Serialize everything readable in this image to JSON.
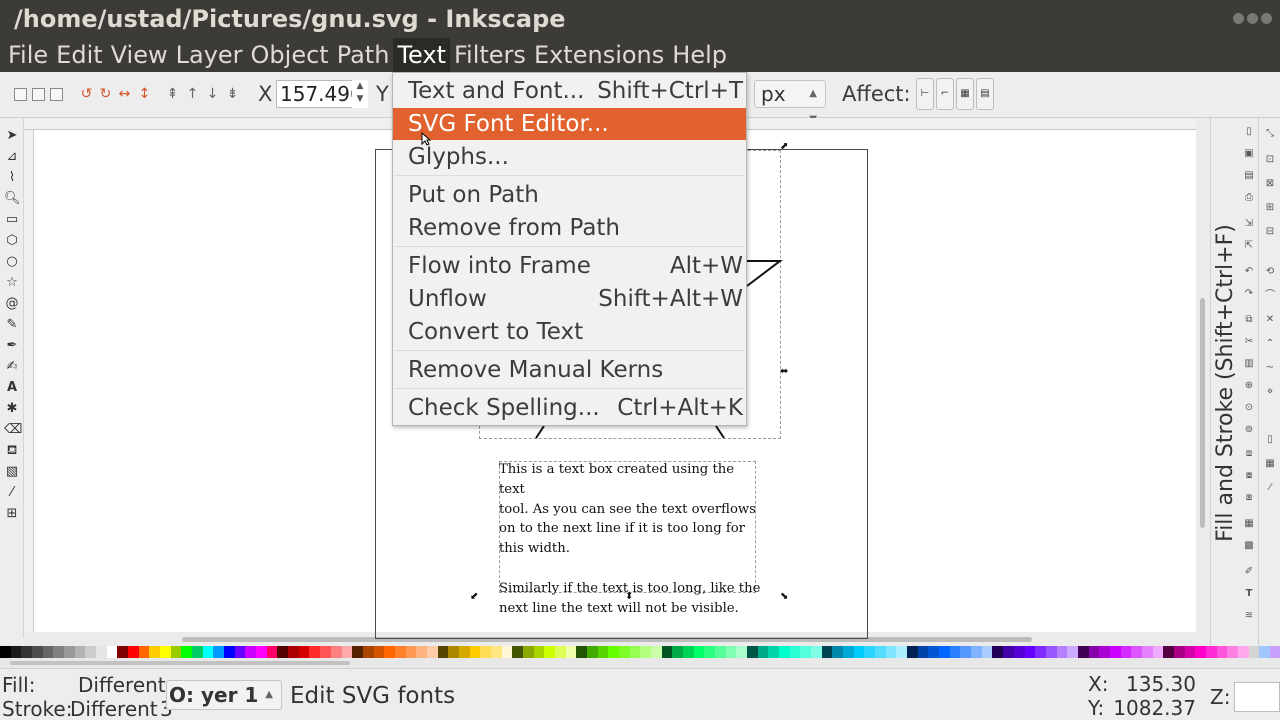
{
  "window": {
    "title": "/home/ustad/Pictures/gnu.svg - Inkscape"
  },
  "menubar": {
    "items": [
      "File",
      "Edit",
      "View",
      "Layer",
      "Object",
      "Path",
      "Text",
      "Filters",
      "Extensions",
      "Help"
    ],
    "active": "Text"
  },
  "toolbar": {
    "x_label": "X",
    "x_value": "157.496",
    "y_label": "Y",
    "unit": "px",
    "affect_label": "Affect:"
  },
  "text_menu": {
    "items": [
      {
        "label": "Text and Font...",
        "shortcut": "Shift+Ctrl+T"
      },
      {
        "label": "SVG Font Editor...",
        "shortcut": "",
        "highlighted": true
      },
      {
        "label": "Glyphs...",
        "shortcut": ""
      },
      {
        "label": "Put on Path",
        "shortcut": ""
      },
      {
        "label": "Remove from Path",
        "shortcut": ""
      },
      {
        "label": "Flow into Frame",
        "shortcut": "Alt+W"
      },
      {
        "label": "Unflow",
        "shortcut": "Shift+Alt+W"
      },
      {
        "label": "Convert to Text",
        "shortcut": ""
      },
      {
        "label": "Remove Manual Kerns",
        "shortcut": ""
      },
      {
        "label": "Check Spelling...",
        "shortcut": "Ctrl+Alt+K"
      }
    ]
  },
  "canvas": {
    "text_lines_p1": [
      "This is a text box created using the text",
      "tool. As you can see the text overflows",
      "on to the next line if it is too long for",
      "this width."
    ],
    "text_lines_p2": [
      "Similarly if the text is too long, like the",
      "next line the text will not be visible."
    ]
  },
  "dock": {
    "title": "Fill and Stroke (Shift+Ctrl+F)"
  },
  "status": {
    "fill_label": "Fill:",
    "fill_value": "Different",
    "stroke_label": "Stroke:",
    "stroke_value": "Different",
    "stroke_width": "3",
    "layer_value": "O: yer 1",
    "message": "Edit SVG fonts",
    "x_label": "X:",
    "x_value": "135.30",
    "y_label": "Y:",
    "y_value": "1082.37",
    "z_label": "Z:"
  },
  "colors": {
    "menu_highlight": "#e2622f",
    "titlebar": "#3c3b37"
  }
}
